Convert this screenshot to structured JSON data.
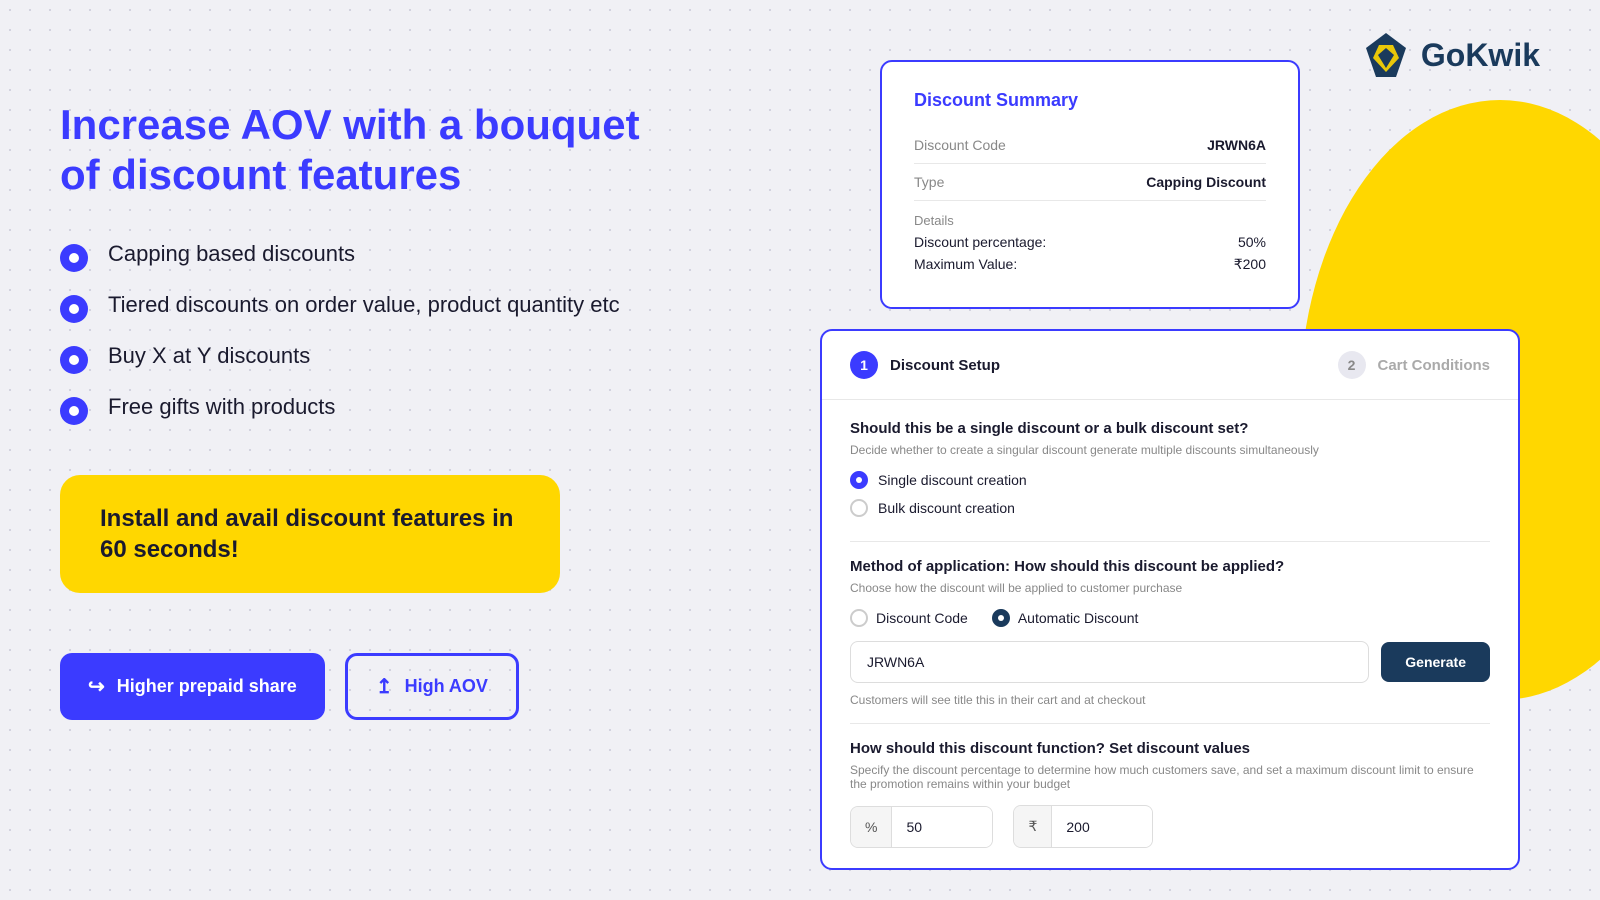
{
  "logo": {
    "text_go": "Go",
    "text_kwik": "Kwik"
  },
  "left": {
    "heading_line1": "Increase AOV with a bouquet",
    "heading_line2": "of discount features",
    "features": [
      {
        "id": "f1",
        "text": "Capping based discounts"
      },
      {
        "id": "f2",
        "text": "Tiered discounts on order value, product quantity etc"
      },
      {
        "id": "f3",
        "text": "Buy X at Y discounts"
      },
      {
        "id": "f4",
        "text": "Free gifts with products"
      }
    ],
    "install_box": {
      "text": "Install and avail discount features in 60 seconds!"
    },
    "btn_prepaid": "Higher prepaid share",
    "btn_aov": "High AOV"
  },
  "discount_summary": {
    "title": "Discount Summary",
    "code_label": "Discount Code",
    "code_value": "JRWN6A",
    "type_label": "Type",
    "type_value": "Capping Discount",
    "details_label": "Details",
    "percentage_label": "Discount percentage:",
    "percentage_value": "50%",
    "max_label": "Maximum Value:",
    "max_value": "₹200"
  },
  "discount_setup": {
    "step1_number": "1",
    "step1_label": "Discount Setup",
    "step2_number": "2",
    "step2_label": "Cart Conditions",
    "section1": {
      "question": "Should this be a single discount or a bulk discount set?",
      "desc": "Decide whether to create a singular discount generate multiple discounts simultaneously",
      "option1": "Single discount creation",
      "option2": "Bulk discount creation"
    },
    "section2": {
      "question": "Method of application: How should this discount be applied?",
      "desc": "Choose how the discount will be applied to customer purchase",
      "option1": "Discount Code",
      "option2": "Automatic Discount",
      "code_value": "JRWN6A",
      "generate_btn": "Generate",
      "hint": "Customers will see title this in their cart and at checkout"
    },
    "section3": {
      "question": "How should this discount function? Set discount values",
      "desc": "Specify the discount percentage to determine how much customers save, and set a maximum discount limit to ensure the promotion remains within your budget",
      "percent_prefix": "%",
      "percent_value": "50",
      "rupee_prefix": "₹",
      "rupee_value": "200"
    }
  }
}
